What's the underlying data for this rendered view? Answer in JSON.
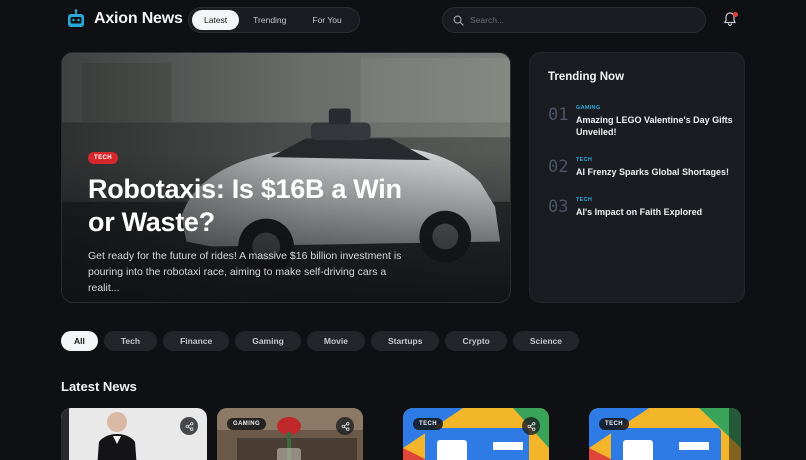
{
  "brand": {
    "name": "Axion News"
  },
  "nav": {
    "tabs": [
      "Latest",
      "Trending",
      "For You"
    ],
    "active": 0
  },
  "search": {
    "placeholder": "Search..."
  },
  "hero": {
    "tag": "TECH",
    "title": "Robotaxis: Is $16B a Win or Waste?",
    "excerpt": "Get ready for the future of rides! A massive $16 billion investment is pouring into the robotaxi race, aiming to make self-driving cars a realit..."
  },
  "trending": {
    "title": "Trending Now",
    "items": [
      {
        "num": "01",
        "category": "GAMING",
        "headline": "Amazing LEGO Valentine's Day Gifts Unveiled!"
      },
      {
        "num": "02",
        "category": "TECH",
        "headline": "AI Frenzy Sparks Global Shortages!"
      },
      {
        "num": "03",
        "category": "TECH",
        "headline": "AI's Impact on Faith Explored"
      }
    ]
  },
  "filters": {
    "items": [
      "All",
      "Tech",
      "Finance",
      "Gaming",
      "Movie",
      "Startups",
      "Crypto",
      "Science"
    ],
    "active": 0
  },
  "latest": {
    "title": "Latest News",
    "cards": [
      {
        "tag": ""
      },
      {
        "tag": "GAMING"
      },
      {
        "tag": "TECH"
      },
      {
        "tag": "TECH"
      }
    ]
  },
  "colors": {
    "accent": "#f4f5f7",
    "tag_red": "#d7282c",
    "category_blue": "#2aa8d8",
    "background": "#0f1013",
    "panel": "#1a1c21"
  }
}
